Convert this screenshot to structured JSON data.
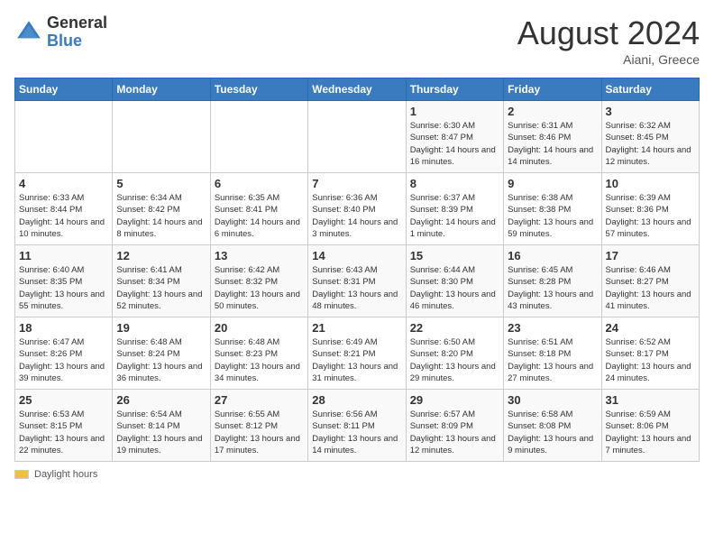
{
  "header": {
    "logo_general": "General",
    "logo_blue": "Blue",
    "month_year": "August 2024",
    "location": "Aiani, Greece"
  },
  "weekdays": [
    "Sunday",
    "Monday",
    "Tuesday",
    "Wednesday",
    "Thursday",
    "Friday",
    "Saturday"
  ],
  "legend": {
    "label": "Daylight hours"
  },
  "weeks": [
    [
      {
        "day": "",
        "info": ""
      },
      {
        "day": "",
        "info": ""
      },
      {
        "day": "",
        "info": ""
      },
      {
        "day": "",
        "info": ""
      },
      {
        "day": "1",
        "info": "Sunrise: 6:30 AM\nSunset: 8:47 PM\nDaylight: 14 hours\nand 16 minutes."
      },
      {
        "day": "2",
        "info": "Sunrise: 6:31 AM\nSunset: 8:46 PM\nDaylight: 14 hours\nand 14 minutes."
      },
      {
        "day": "3",
        "info": "Sunrise: 6:32 AM\nSunset: 8:45 PM\nDaylight: 14 hours\nand 12 minutes."
      }
    ],
    [
      {
        "day": "4",
        "info": "Sunrise: 6:33 AM\nSunset: 8:44 PM\nDaylight: 14 hours\nand 10 minutes."
      },
      {
        "day": "5",
        "info": "Sunrise: 6:34 AM\nSunset: 8:42 PM\nDaylight: 14 hours\nand 8 minutes."
      },
      {
        "day": "6",
        "info": "Sunrise: 6:35 AM\nSunset: 8:41 PM\nDaylight: 14 hours\nand 6 minutes."
      },
      {
        "day": "7",
        "info": "Sunrise: 6:36 AM\nSunset: 8:40 PM\nDaylight: 14 hours\nand 3 minutes."
      },
      {
        "day": "8",
        "info": "Sunrise: 6:37 AM\nSunset: 8:39 PM\nDaylight: 14 hours\nand 1 minute."
      },
      {
        "day": "9",
        "info": "Sunrise: 6:38 AM\nSunset: 8:38 PM\nDaylight: 13 hours\nand 59 minutes."
      },
      {
        "day": "10",
        "info": "Sunrise: 6:39 AM\nSunset: 8:36 PM\nDaylight: 13 hours\nand 57 minutes."
      }
    ],
    [
      {
        "day": "11",
        "info": "Sunrise: 6:40 AM\nSunset: 8:35 PM\nDaylight: 13 hours\nand 55 minutes."
      },
      {
        "day": "12",
        "info": "Sunrise: 6:41 AM\nSunset: 8:34 PM\nDaylight: 13 hours\nand 52 minutes."
      },
      {
        "day": "13",
        "info": "Sunrise: 6:42 AM\nSunset: 8:32 PM\nDaylight: 13 hours\nand 50 minutes."
      },
      {
        "day": "14",
        "info": "Sunrise: 6:43 AM\nSunset: 8:31 PM\nDaylight: 13 hours\nand 48 minutes."
      },
      {
        "day": "15",
        "info": "Sunrise: 6:44 AM\nSunset: 8:30 PM\nDaylight: 13 hours\nand 46 minutes."
      },
      {
        "day": "16",
        "info": "Sunrise: 6:45 AM\nSunset: 8:28 PM\nDaylight: 13 hours\nand 43 minutes."
      },
      {
        "day": "17",
        "info": "Sunrise: 6:46 AM\nSunset: 8:27 PM\nDaylight: 13 hours\nand 41 minutes."
      }
    ],
    [
      {
        "day": "18",
        "info": "Sunrise: 6:47 AM\nSunset: 8:26 PM\nDaylight: 13 hours\nand 39 minutes."
      },
      {
        "day": "19",
        "info": "Sunrise: 6:48 AM\nSunset: 8:24 PM\nDaylight: 13 hours\nand 36 minutes."
      },
      {
        "day": "20",
        "info": "Sunrise: 6:48 AM\nSunset: 8:23 PM\nDaylight: 13 hours\nand 34 minutes."
      },
      {
        "day": "21",
        "info": "Sunrise: 6:49 AM\nSunset: 8:21 PM\nDaylight: 13 hours\nand 31 minutes."
      },
      {
        "day": "22",
        "info": "Sunrise: 6:50 AM\nSunset: 8:20 PM\nDaylight: 13 hours\nand 29 minutes."
      },
      {
        "day": "23",
        "info": "Sunrise: 6:51 AM\nSunset: 8:18 PM\nDaylight: 13 hours\nand 27 minutes."
      },
      {
        "day": "24",
        "info": "Sunrise: 6:52 AM\nSunset: 8:17 PM\nDaylight: 13 hours\nand 24 minutes."
      }
    ],
    [
      {
        "day": "25",
        "info": "Sunrise: 6:53 AM\nSunset: 8:15 PM\nDaylight: 13 hours\nand 22 minutes."
      },
      {
        "day": "26",
        "info": "Sunrise: 6:54 AM\nSunset: 8:14 PM\nDaylight: 13 hours\nand 19 minutes."
      },
      {
        "day": "27",
        "info": "Sunrise: 6:55 AM\nSunset: 8:12 PM\nDaylight: 13 hours\nand 17 minutes."
      },
      {
        "day": "28",
        "info": "Sunrise: 6:56 AM\nSunset: 8:11 PM\nDaylight: 13 hours\nand 14 minutes."
      },
      {
        "day": "29",
        "info": "Sunrise: 6:57 AM\nSunset: 8:09 PM\nDaylight: 13 hours\nand 12 minutes."
      },
      {
        "day": "30",
        "info": "Sunrise: 6:58 AM\nSunset: 8:08 PM\nDaylight: 13 hours\nand 9 minutes."
      },
      {
        "day": "31",
        "info": "Sunrise: 6:59 AM\nSunset: 8:06 PM\nDaylight: 13 hours\nand 7 minutes."
      }
    ]
  ]
}
